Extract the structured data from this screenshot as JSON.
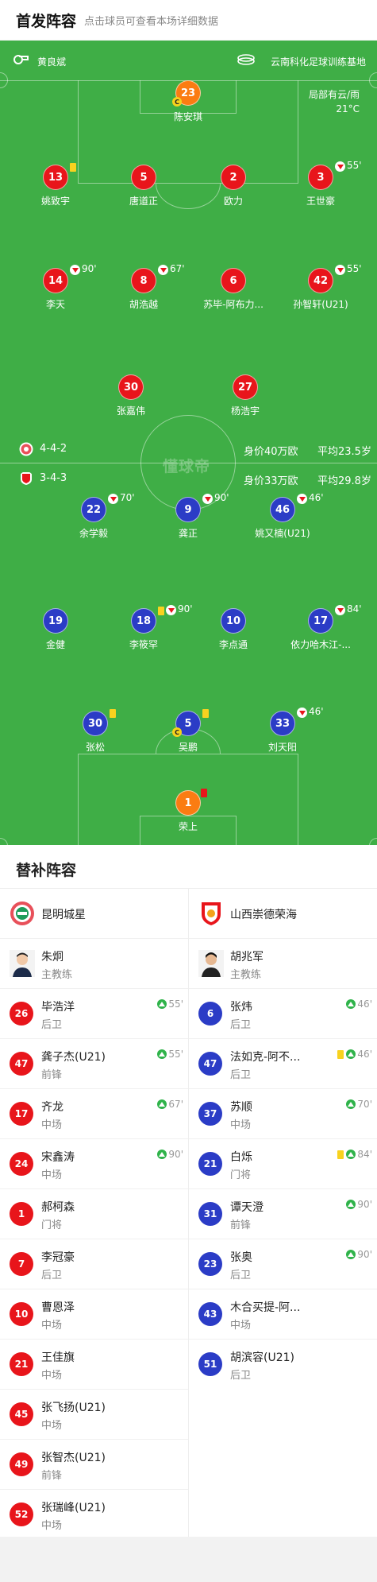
{
  "header": {
    "title": "首发阵容",
    "subtitle": "点击球员可查看本场详细数据"
  },
  "pitch": {
    "referee": "黄良斌",
    "venue": "云南科化足球训练基地",
    "weather": "局部有云/雨",
    "temperature": "21°C",
    "watermark": "懂球帝",
    "home": {
      "formation": "4-4-2",
      "value": "身价40万欧",
      "age": "平均23.5岁",
      "color": "#e8151b"
    },
    "away": {
      "formation": "3-4-3",
      "value": "身价33万欧",
      "age": "平均29.8岁",
      "color": "#2b3cc6"
    },
    "home_players": [
      {
        "num": "23",
        "name": "陈安琪",
        "gk": true,
        "captain": true
      },
      {
        "num": "13",
        "name": "姚致宇",
        "yellow": true
      },
      {
        "num": "5",
        "name": "唐道正"
      },
      {
        "num": "2",
        "name": "欧力"
      },
      {
        "num": "3",
        "name": "王世豪",
        "out": "55'"
      },
      {
        "num": "14",
        "name": "李天",
        "out": "90'"
      },
      {
        "num": "8",
        "name": "胡浩越",
        "out": "67'"
      },
      {
        "num": "6",
        "name": "苏毕-阿布力..."
      },
      {
        "num": "42",
        "name": "孙智轩(U21)",
        "out": "55'"
      },
      {
        "num": "30",
        "name": "张嘉伟"
      },
      {
        "num": "27",
        "name": "杨浩宇"
      }
    ],
    "away_players": [
      {
        "num": "22",
        "name": "余学毅",
        "out": "70'"
      },
      {
        "num": "9",
        "name": "龚正",
        "out": "90'"
      },
      {
        "num": "46",
        "name": "姚又楠(U21)",
        "out": "46'"
      },
      {
        "num": "19",
        "name": "金健"
      },
      {
        "num": "18",
        "name": "李筱罕",
        "yellow": true,
        "out": "90'"
      },
      {
        "num": "10",
        "name": "李点通"
      },
      {
        "num": "17",
        "name": "依力哈木江-...",
        "out": "84'"
      },
      {
        "num": "30",
        "name": "张松",
        "yellow": true
      },
      {
        "num": "5",
        "name": "吴鹏",
        "yellow": true,
        "captain": true
      },
      {
        "num": "33",
        "name": "刘天阳",
        "out": "46'"
      },
      {
        "num": "1",
        "name": "荣上",
        "gk": true,
        "red": true
      }
    ]
  },
  "subs": {
    "title": "替补阵容",
    "home": {
      "club": "昆明城星",
      "coach": {
        "name": "朱炯",
        "role": "主教练"
      },
      "players": [
        {
          "num": "26",
          "name": "毕浩洋",
          "pos": "后卫",
          "in": "55'"
        },
        {
          "num": "47",
          "name": "龚子杰(U21)",
          "pos": "前锋",
          "in": "55'"
        },
        {
          "num": "17",
          "name": "齐龙",
          "pos": "中场",
          "in": "67'"
        },
        {
          "num": "24",
          "name": "宋鑫涛",
          "pos": "中场",
          "in": "90'"
        },
        {
          "num": "1",
          "name": "郝柯森",
          "pos": "门将"
        },
        {
          "num": "7",
          "name": "李冠豪",
          "pos": "后卫"
        },
        {
          "num": "10",
          "name": "曹恩泽",
          "pos": "中场"
        },
        {
          "num": "21",
          "name": "王佳旗",
          "pos": "中场"
        },
        {
          "num": "45",
          "name": "张飞扬(U21)",
          "pos": "中场"
        },
        {
          "num": "49",
          "name": "张智杰(U21)",
          "pos": "前锋"
        },
        {
          "num": "52",
          "name": "张瑞峰(U21)",
          "pos": "中场"
        }
      ]
    },
    "away": {
      "club": "山西崇德荣海",
      "coach": {
        "name": "胡兆军",
        "role": "主教练"
      },
      "players": [
        {
          "num": "6",
          "name": "张炜",
          "pos": "后卫",
          "in": "46'"
        },
        {
          "num": "47",
          "name": "法如克-阿不...",
          "pos": "后卫",
          "in": "46'",
          "yellow": true
        },
        {
          "num": "37",
          "name": "苏顺",
          "pos": "中场",
          "in": "70'"
        },
        {
          "num": "21",
          "name": "白烁",
          "pos": "门将",
          "in": "84'",
          "yellow": true
        },
        {
          "num": "31",
          "name": "谭天澄",
          "pos": "前锋",
          "in": "90'"
        },
        {
          "num": "23",
          "name": "张奥",
          "pos": "后卫",
          "in": "90'"
        },
        {
          "num": "43",
          "name": "木合买提-阿...",
          "pos": "中场"
        },
        {
          "num": "51",
          "name": "胡滨容(U21)",
          "pos": "后卫"
        }
      ]
    }
  }
}
